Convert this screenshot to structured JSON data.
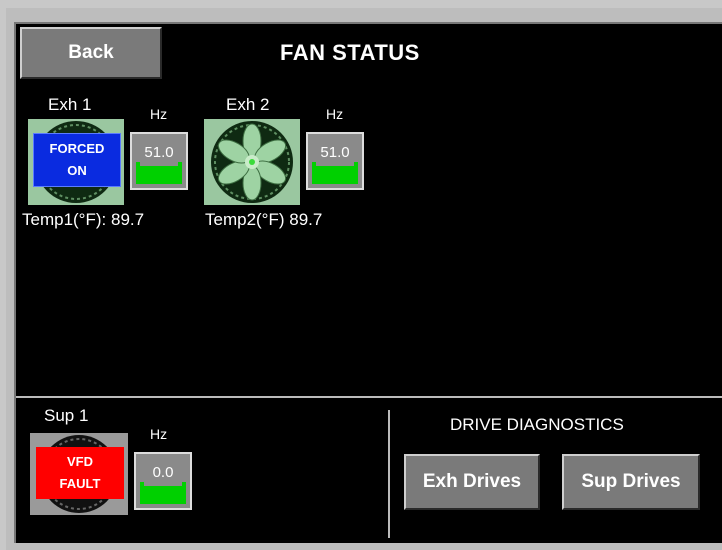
{
  "header": {
    "back_label": "Back",
    "title": "FAN STATUS"
  },
  "exhaust_fans": [
    {
      "name": "Exh 1",
      "hz_unit": "Hz",
      "hz_value": "51.0",
      "status_line1": "FORCED",
      "status_line2": "ON",
      "temp_label": "Temp1(°F):",
      "temp_value": "89.7"
    },
    {
      "name": "Exh 2",
      "hz_unit": "Hz",
      "hz_value": "51.0",
      "temp_label": "Temp2(°F)",
      "temp_value": "89.7"
    }
  ],
  "supply_fan": {
    "name": "Sup 1",
    "hz_unit": "Hz",
    "hz_value": "0.0",
    "status_line1": "VFD",
    "status_line2": "FAULT"
  },
  "diagnostics": {
    "title": "DRIVE DIAGNOSTICS",
    "exh_button": "Exh Drives",
    "sup_button": "Sup Drives"
  },
  "colors": {
    "forced_on": "#0a2be0",
    "fault": "#ff0000",
    "hz_bar": "#00d000",
    "fan_running": "#9ac7a0"
  },
  "icons": {
    "fan": "fan-icon"
  }
}
